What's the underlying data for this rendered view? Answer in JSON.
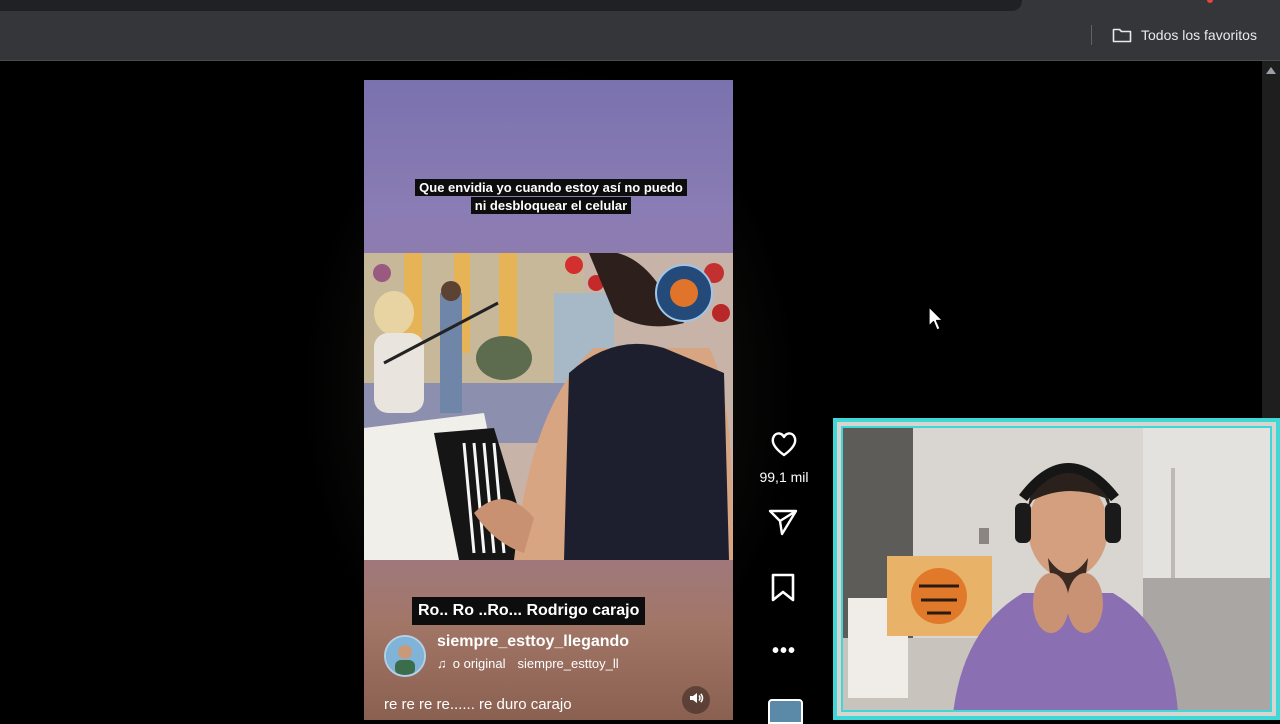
{
  "browser": {
    "bookmarks_bar": {
      "all_bookmarks_label": "Todos los favoritos",
      "folder_icon": "folder-icon"
    }
  },
  "video": {
    "caption_top": "Que envidia yo cuando estoy así no puedo ni desbloquear el celular",
    "watermark_icon": "planeta-logo-icon",
    "caption_bottom": "Ro.. Ro ..Ro...  Rodrigo carajo",
    "author": {
      "username": "siempre_esttoy_llegando"
    },
    "audio": {
      "icon": "music-note-icon",
      "title": "o original",
      "creator": "siempre_esttoy_ll"
    },
    "description": "re re re re...... re duro carajo",
    "mute_icon": "speaker-icon"
  },
  "actions": {
    "like": {
      "icon": "heart-icon",
      "count": "99,1 mil"
    },
    "share": {
      "icon": "send-icon"
    },
    "save": {
      "icon": "bookmark-icon"
    },
    "more": {
      "icon": "more-icon",
      "label": "•••"
    }
  },
  "colors": {
    "webcam_border": "#3fd8d6",
    "browser_chrome": "#35363a"
  }
}
